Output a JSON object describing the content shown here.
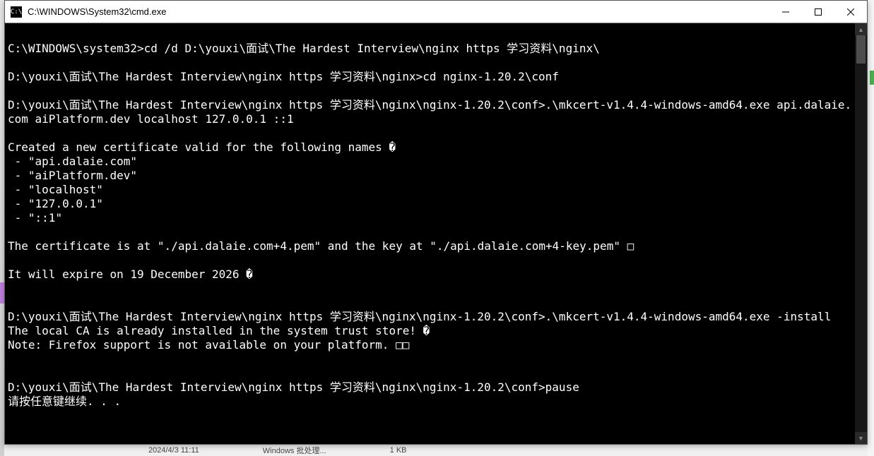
{
  "window": {
    "title": "C:\\WINDOWS\\System32\\cmd.exe",
    "icon_label": "cmd-icon",
    "icon_text": "C:\\"
  },
  "terminal": {
    "lines": "\nC:\\WINDOWS\\system32>cd /d D:\\youxi\\面试\\The Hardest Interview\\nginx https 学习资料\\nginx\\\n\nD:\\youxi\\面试\\The Hardest Interview\\nginx https 学习资料\\nginx>cd nginx-1.20.2\\conf\n\nD:\\youxi\\面试\\The Hardest Interview\\nginx https 学习资料\\nginx\\nginx-1.20.2\\conf>.\\mkcert-v1.4.4-windows-amd64.exe api.dalaie.com aiPlatform.dev localhost 127.0.0.1 ::1\n\nCreated a new certificate valid for the following names �\n - \"api.dalaie.com\"\n - \"aiPlatform.dev\"\n - \"localhost\"\n - \"127.0.0.1\"\n - \"::1\"\n\nThe certificate is at \"./api.dalaie.com+4.pem\" and the key at \"./api.dalaie.com+4-key.pem\" □\n\nIt will expire on 19 December 2026 �\n\n\nD:\\youxi\\面试\\The Hardest Interview\\nginx https 学习资料\\nginx\\nginx-1.20.2\\conf>.\\mkcert-v1.4.4-windows-amd64.exe -install\nThe local CA is already installed in the system trust store! �\nNote: Firefox support is not available on your platform. □□\n\n\nD:\\youxi\\面试\\The Hardest Interview\\nginx https 学习资料\\nginx\\nginx-1.20.2\\conf>pause\n请按任意键继续. . ."
  },
  "background": {
    "date": "2024/4/3 11:11",
    "col2": "Windows 批处理...",
    "col3": "1 KB"
  }
}
